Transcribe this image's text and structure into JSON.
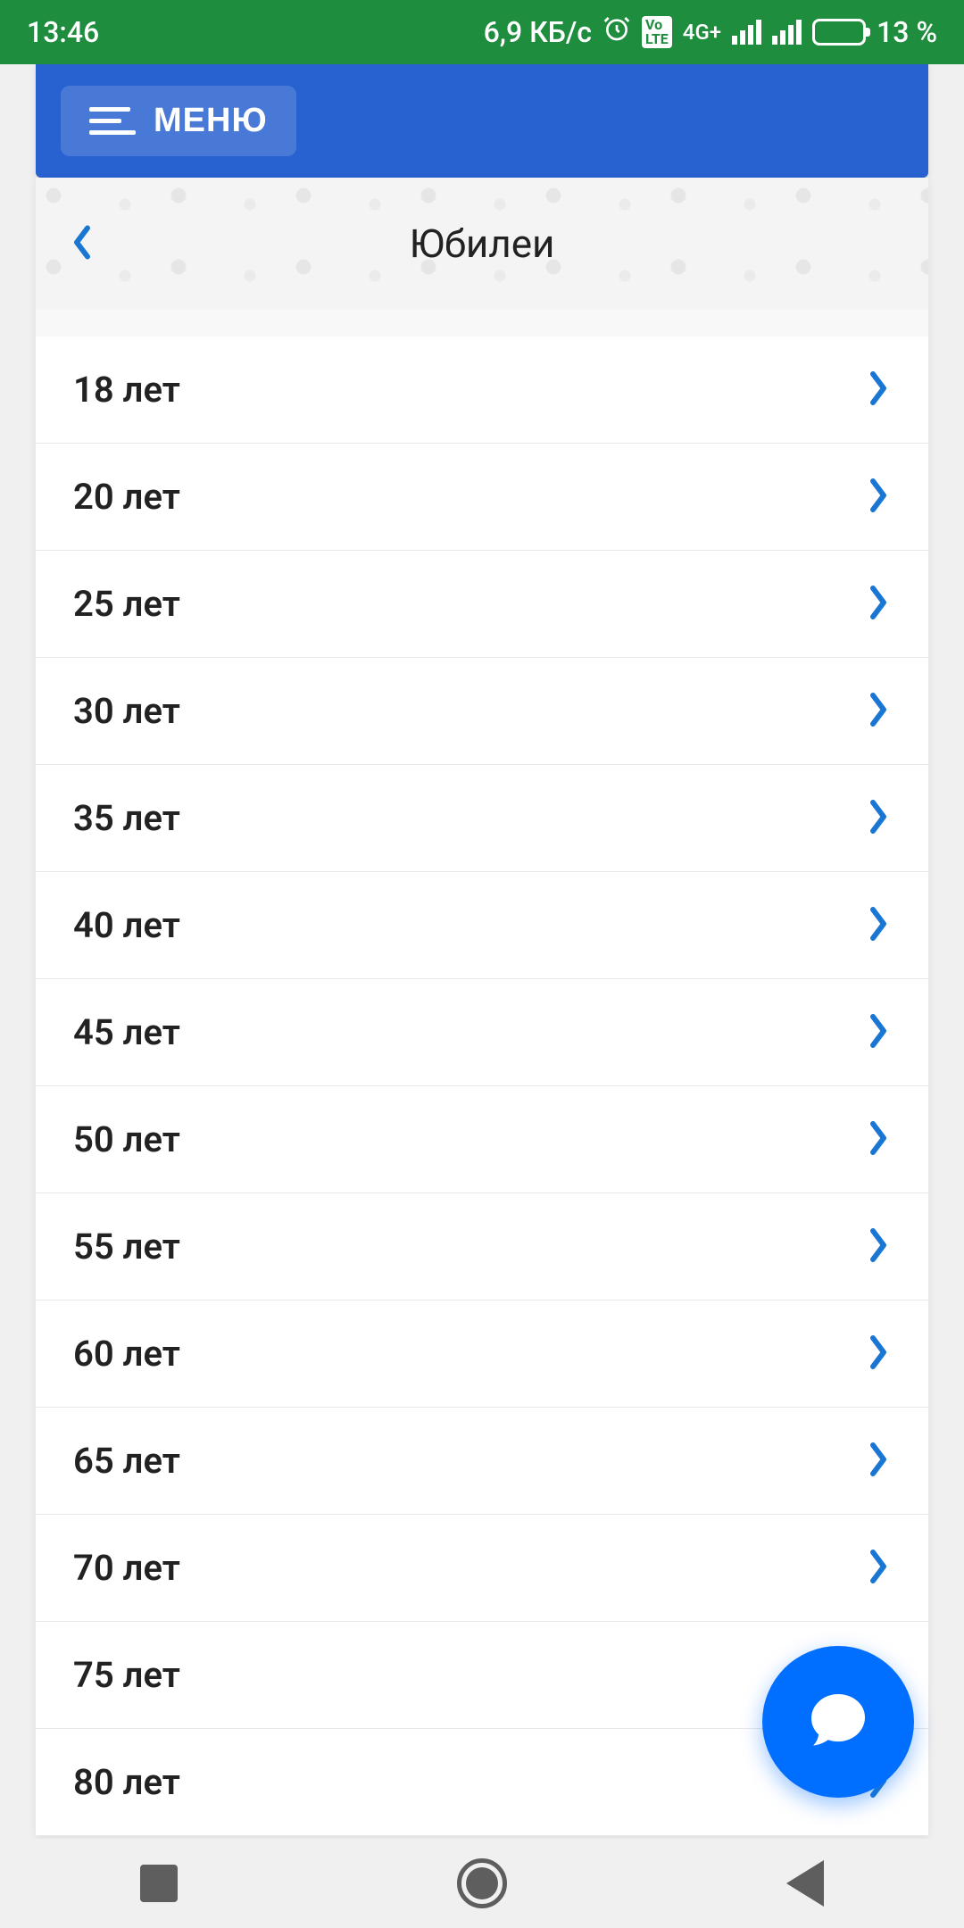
{
  "statusBar": {
    "time": "13:46",
    "dataSpeed": "6,9 КБ/с",
    "networkLabel": "4G+",
    "volteLabel": "Vo LTE",
    "batteryPercent": "13 %"
  },
  "header": {
    "menuLabel": "МЕНЮ"
  },
  "page": {
    "title": "Юбилеи"
  },
  "list": {
    "items": [
      {
        "label": "18 лет"
      },
      {
        "label": "20 лет"
      },
      {
        "label": "25 лет"
      },
      {
        "label": "30 лет"
      },
      {
        "label": "35 лет"
      },
      {
        "label": "40 лет"
      },
      {
        "label": "45 лет"
      },
      {
        "label": "50 лет"
      },
      {
        "label": "55 лет"
      },
      {
        "label": "60 лет"
      },
      {
        "label": "65 лет"
      },
      {
        "label": "70 лет"
      },
      {
        "label": "75 лет"
      },
      {
        "label": "80 лет"
      }
    ]
  }
}
